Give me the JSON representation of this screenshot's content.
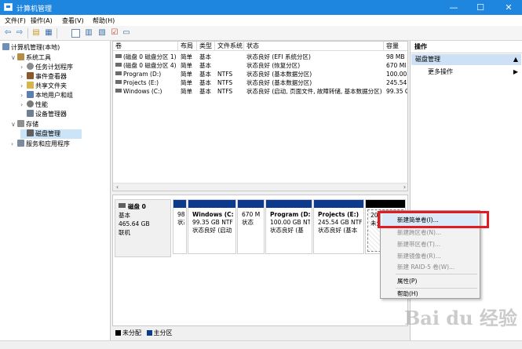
{
  "window": {
    "title": "计算机管理",
    "controls": {
      "minimize": "—",
      "maximize": "☐",
      "close": "✕"
    }
  },
  "menu": [
    "文件(F)",
    "操作(A)",
    "查看(V)",
    "帮助(H)"
  ],
  "tree": {
    "root": "计算机管理(本地)",
    "system_tools": "系统工具",
    "task_scheduler": "任务计划程序",
    "event_viewer": "事件查看器",
    "shared_folders": "共享文件夹",
    "local_users": "本地用户和组",
    "performance": "性能",
    "device_manager": "设备管理器",
    "storage": "存储",
    "disk_management": "磁盘管理",
    "services": "服务和应用程序"
  },
  "volume_table": {
    "headers": [
      "卷",
      "布局",
      "类型",
      "文件系统",
      "状态",
      "容量"
    ],
    "rows": [
      [
        "(磁盘 0 磁盘分区 1)",
        "简单",
        "基本",
        "",
        "状态良好 (EFI 系统分区)",
        "98 MB"
      ],
      [
        "(磁盘 0 磁盘分区 4)",
        "简单",
        "基本",
        "",
        "状态良好 (恢复分区)",
        "670 MI"
      ],
      [
        "Program (D:)",
        "简单",
        "基本",
        "NTFS",
        "状态良好 (基本数据分区)",
        "100.00"
      ],
      [
        "Projects (E:)",
        "简单",
        "基本",
        "NTFS",
        "状态良好 (基本数据分区)",
        "245.54"
      ],
      [
        "Windows (C:)",
        "简单",
        "基本",
        "NTFS",
        "状态良好 (启动, 页面文件, 故障转储, 基本数据分区)",
        "99.35 G"
      ]
    ]
  },
  "disk": {
    "name": "磁盘 0",
    "type": "基本",
    "size": "465.64 GB",
    "state": "联机"
  },
  "partitions": [
    {
      "label": "",
      "size": "98 M",
      "status": "状态"
    },
    {
      "label": "Windows (C:",
      "size": "99.35 GB NTF",
      "status": "状态良好 (启动"
    },
    {
      "label": "",
      "size": "670 M",
      "status": "状态"
    },
    {
      "label": "Program (D:",
      "size": "100.00 GB NTF",
      "status": "状态良好 (基"
    },
    {
      "label": "Projects (E:)",
      "size": "245.54 GB NTF",
      "status": "状态良好 (基本"
    },
    {
      "label": "",
      "size": "20.0",
      "status": "未分"
    }
  ],
  "legend": {
    "unallocated": "未分配",
    "primary": "主分区"
  },
  "actions": {
    "title": "操作",
    "section": "磁盘管理",
    "more": "更多操作"
  },
  "context_menu": [
    "新建简单卷(I)...",
    "新建跨区卷(N)...",
    "新建带区卷(T)...",
    "新建镜像卷(R)...",
    "新建 RAID-5 卷(W)...",
    "属性(P)",
    "帮助(H)"
  ],
  "colors": {
    "accent": "#1f86e0",
    "primary_partition": "#0b3a8f",
    "unallocated": "#000000",
    "highlight": "#e21c23"
  },
  "watermark": "Bai du 经验"
}
